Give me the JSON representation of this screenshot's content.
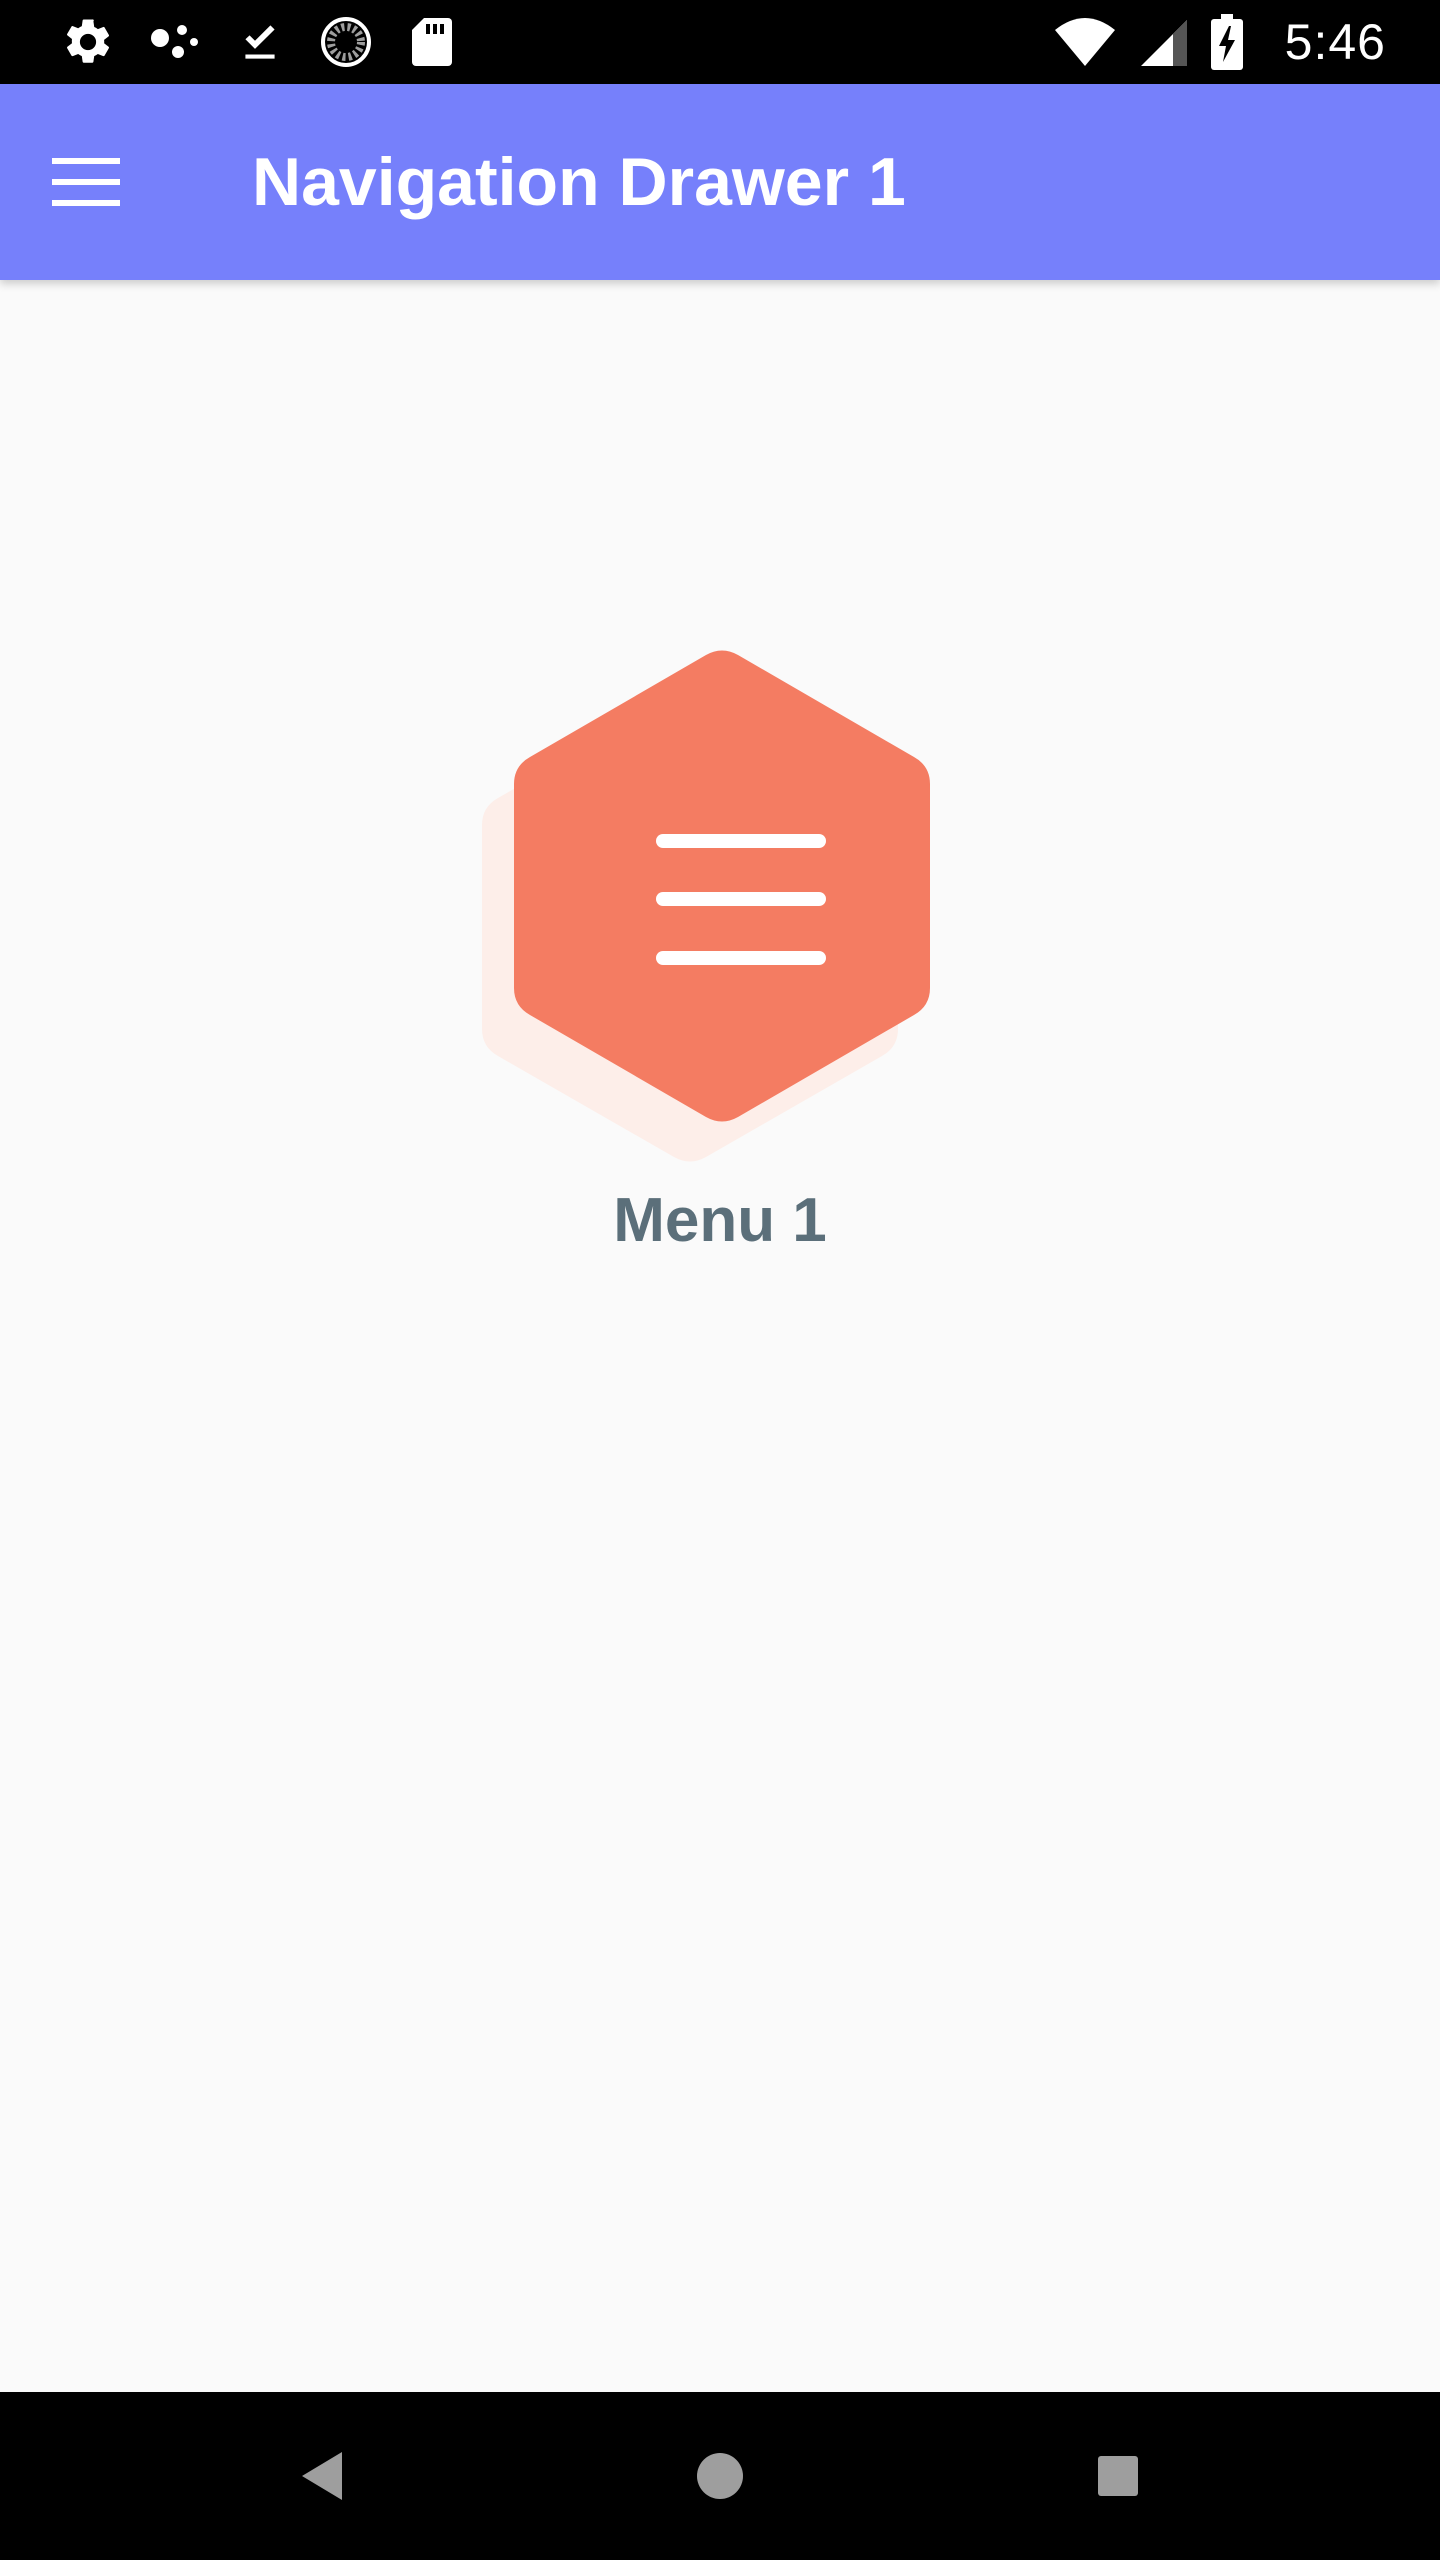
{
  "status_bar": {
    "time": "5:46",
    "left_icons": [
      "settings-icon",
      "assistant-dots-icon",
      "download-done-icon",
      "sync-progress-icon",
      "sd-card-icon"
    ],
    "right_icons": [
      "wifi-icon",
      "cellular-signal-icon",
      "battery-charging-icon"
    ]
  },
  "app_bar": {
    "title": "Navigation Drawer 1",
    "menu_icon": "hamburger-menu-icon",
    "background_color": "#7680fb"
  },
  "content": {
    "hero_icon": "hexagon-menu-icon",
    "hero_color": "#f47c62",
    "label": "Menu 1",
    "label_color": "#5b6f7a"
  },
  "nav_bar": {
    "back_icon": "back-triangle-icon",
    "home_icon": "home-circle-icon",
    "recents_icon": "recents-square-icon"
  }
}
